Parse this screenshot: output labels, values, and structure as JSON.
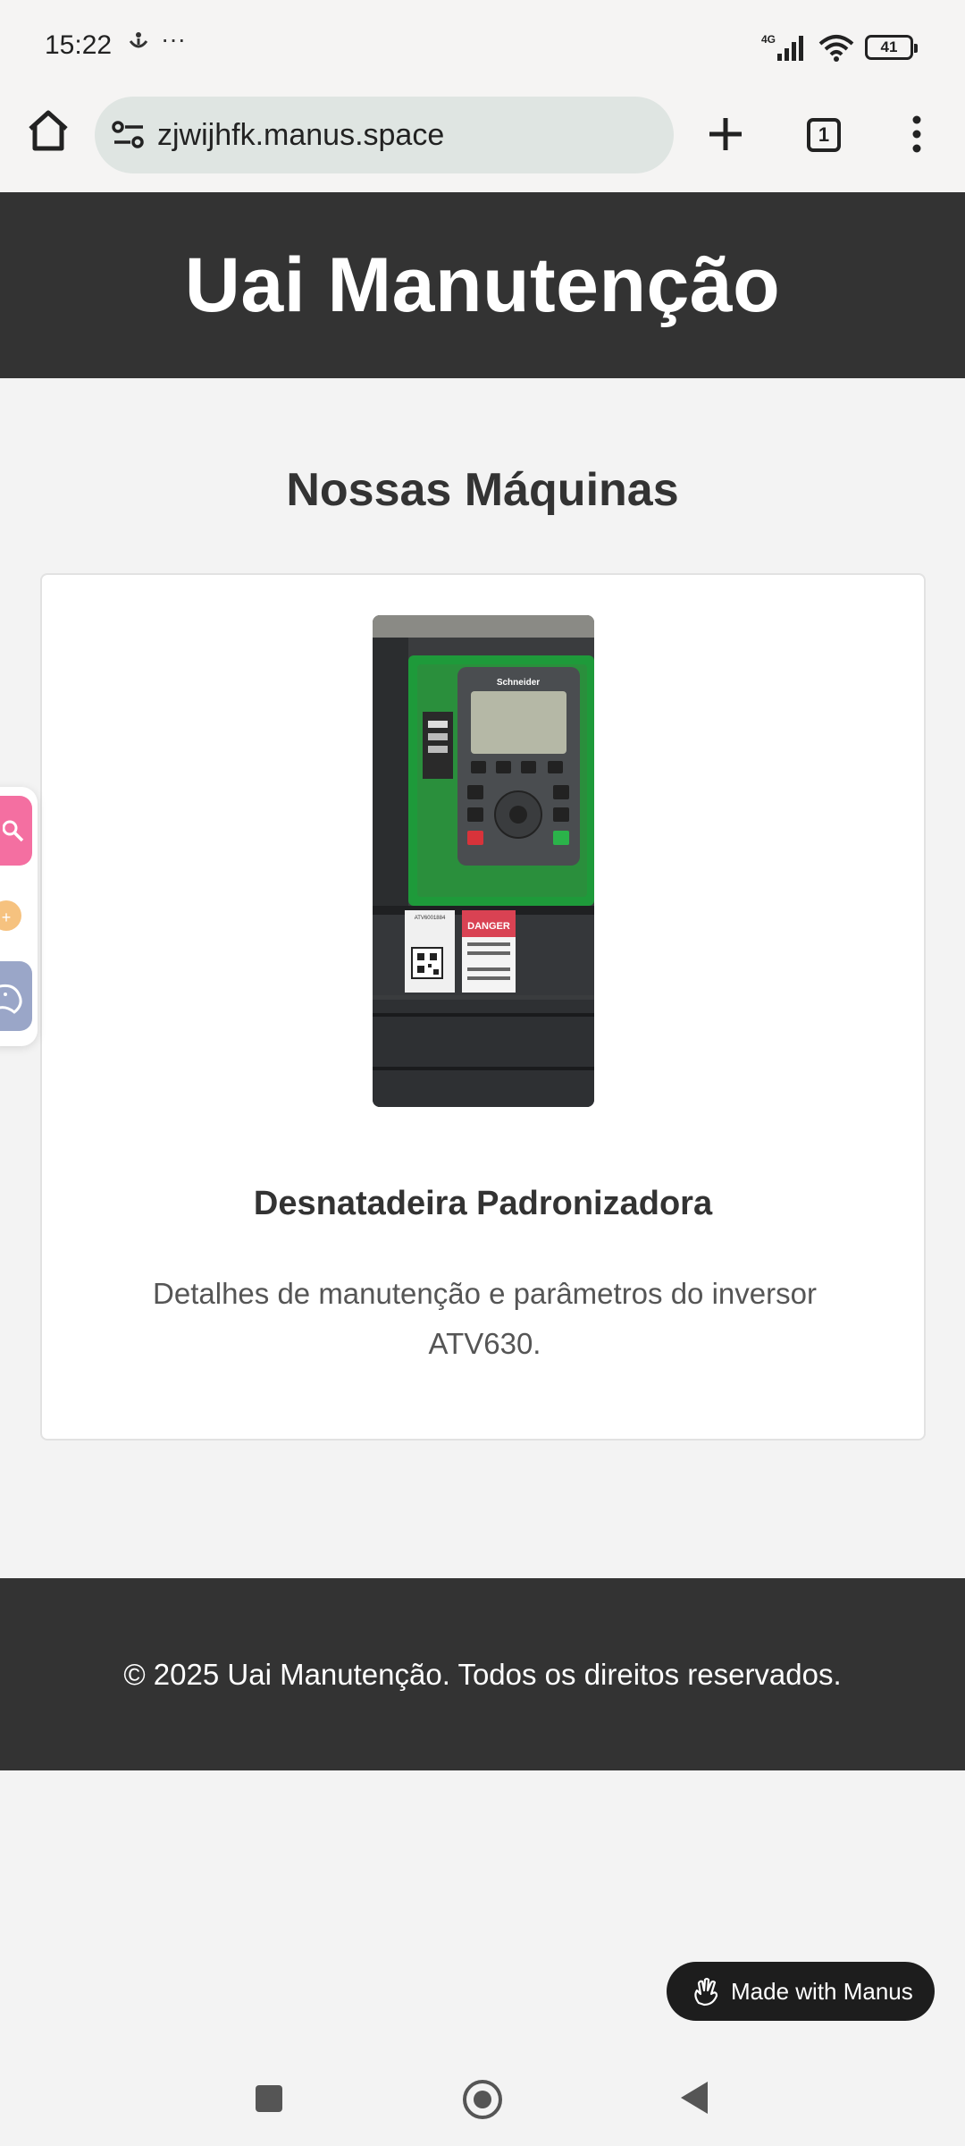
{
  "status_bar": {
    "time": "15:22",
    "left_icons": [
      "accessibility-icon",
      "more-dots-icon"
    ],
    "more_dots": "···",
    "network": "4G",
    "battery": "41"
  },
  "browser": {
    "url": "zjwijhfk.manus.space",
    "tab_count": "1"
  },
  "header": {
    "title": "Uai Manutenção"
  },
  "main": {
    "section_title": "Nossas Máquinas",
    "card": {
      "title": "Desnatadeira Padronizadora",
      "description": "Detalhes de manutenção e parâmetros do inversor ATV630.",
      "photo": {
        "brand": "Schneider",
        "label_code": "ATV6001884",
        "warning_text": "DANGER"
      }
    }
  },
  "footer": {
    "text": "© 2025 Uai Manutenção. Todos os direitos reservados."
  },
  "badge": {
    "label": "Made with Manus"
  },
  "colors": {
    "header_bg": "#333333",
    "page_bg": "#f3f3f3",
    "url_bg": "#dfe5e2",
    "device_green": "#1e9a3a",
    "badge_bg": "#1d1d1d"
  }
}
